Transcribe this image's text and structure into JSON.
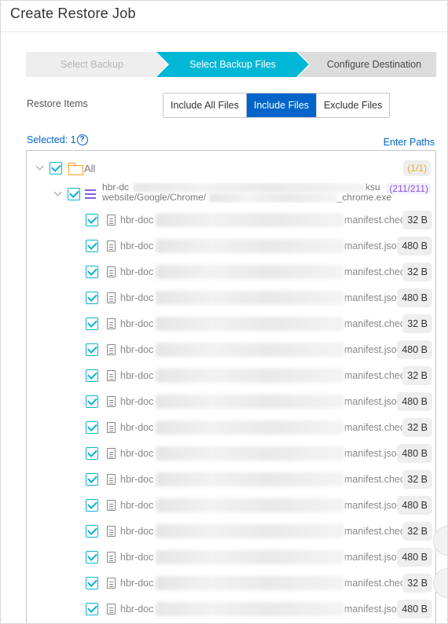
{
  "dialog": {
    "title": "Create Restore Job"
  },
  "steps": [
    "Select Backup",
    "Select Backup Files",
    "Configure Destination"
  ],
  "restore_items": {
    "label": "Restore Items",
    "options": [
      "Include All Files",
      "Include Files",
      "Exclude Files"
    ],
    "selected": "Include Files"
  },
  "selection": {
    "selected_label": "Selected: 1",
    "help_icon": "?",
    "enter_paths": "Enter Paths"
  },
  "tree": {
    "root": {
      "label": "All",
      "count": "(1/1)"
    },
    "source": {
      "name_line1": "hbr-dc",
      "name_line1_end": "ksu",
      "name_line2": "website/Google/Chrome/",
      "name_line2_end": "_chrome.exe",
      "count": "(211/211)"
    },
    "files": [
      {
        "prefix": "hbr-doc",
        "suffix": "manifest.checksum",
        "size": "32 B"
      },
      {
        "prefix": "hbr-doc",
        "suffix": "manifest.json",
        "size": "480 B"
      },
      {
        "prefix": "hbr-doc",
        "suffix": "manifest.checksum",
        "size": "32 B"
      },
      {
        "prefix": "hbr-doc",
        "suffix": "manifest.json",
        "size": "480 B"
      },
      {
        "prefix": "hbr-doc",
        "suffix": "manifest.checksum",
        "size": "32 B"
      },
      {
        "prefix": "hbr-doc",
        "suffix": "manifest.json",
        "size": "480 B"
      },
      {
        "prefix": "hbr-doc",
        "suffix": "manifest.checksum",
        "size": "32 B"
      },
      {
        "prefix": "hbr-doc",
        "suffix": "manifest.json",
        "size": "480 B"
      },
      {
        "prefix": "hbr-doc",
        "suffix": "manifest.checksum",
        "size": "32 B"
      },
      {
        "prefix": "hbr-doc",
        "suffix": "manifest.json",
        "size": "480 B"
      },
      {
        "prefix": "hbr-doc",
        "suffix": "manifest.checksum",
        "size": "32 B"
      },
      {
        "prefix": "hbr-doc",
        "suffix": "manifest.json",
        "size": "480 B"
      },
      {
        "prefix": "hbr-doc",
        "suffix": "manifest.checksum",
        "size": "32 B"
      },
      {
        "prefix": "hbr-doc",
        "suffix": "manifest.json",
        "size": "480 B"
      },
      {
        "prefix": "hbr-doc",
        "suffix": "manifest.checksum",
        "size": "32 B"
      },
      {
        "prefix": "hbr-doc",
        "suffix": "manifest.json",
        "size": "480 B"
      }
    ]
  },
  "colors": {
    "accent": "#00b7d6",
    "primary": "#0064c8",
    "folder": "#f5a623",
    "source": "#8a5cd6"
  }
}
